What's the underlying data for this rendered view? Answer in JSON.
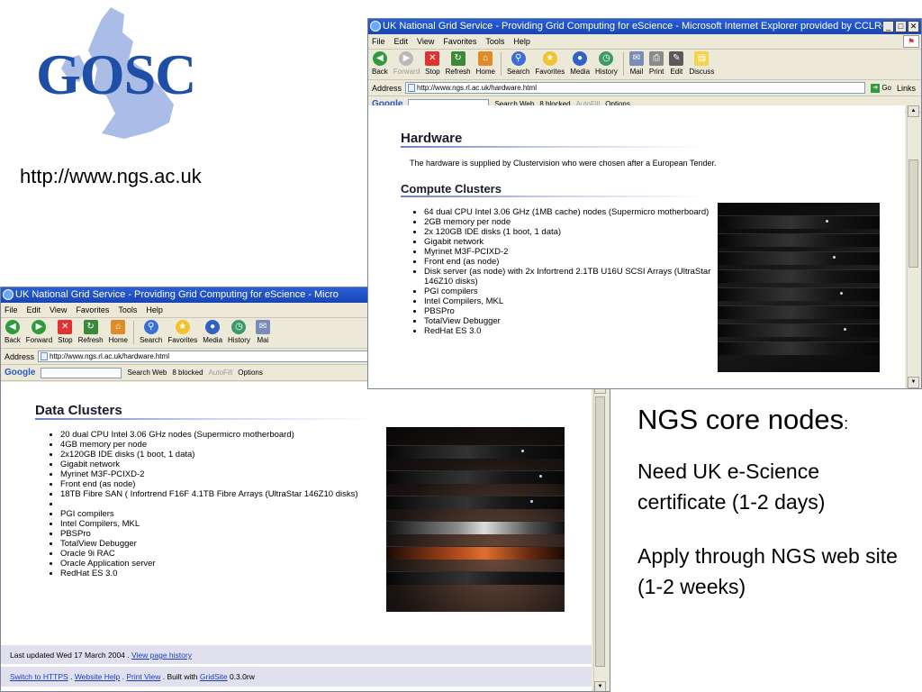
{
  "slide": {
    "logo_text": "GOSC",
    "url": "http://www.ngs.ac.uk",
    "notes_title": "NGS core nodes",
    "notes_title_colon": ":",
    "notes": [
      "Need UK e-Science certificate (1-2 days)",
      "Apply through NGS web site (1-2 weeks)"
    ]
  },
  "back_window": {
    "title": "UK National Grid Service - Providing Grid Computing for eScience - Micro",
    "menu": [
      "File",
      "Edit",
      "View",
      "Favorites",
      "Tools",
      "Help"
    ],
    "toolbar": [
      "Back",
      "Forward",
      "Stop",
      "Refresh",
      "Home",
      "Search",
      "Favorites",
      "Media",
      "History",
      "Mai"
    ],
    "address_label": "Address",
    "address": "http://www.ngs.rl.ac.uk/hardware.html",
    "google": {
      "logo": "Google",
      "search_web": "Search Web",
      "blocked": "8 blocked",
      "autofill": "AutoFill",
      "options": "Options"
    },
    "page": {
      "heading": "Data Clusters",
      "items": [
        "20 dual CPU Intel 3.06 GHz nodes (Supermicro motherboard)",
        "4GB memory per node",
        "2x120GB IDE disks (1 boot, 1 data)",
        "Gigabit network",
        "Myrinet M3F-PCIXD-2",
        "Front end (as node)",
        "18TB Fibre SAN ( Infortrend F16F 4.1TB Fibre Arrays (UltraStar 146Z10 disks)",
        "",
        "PGI compilers",
        "Intel Compilers, MKL",
        "PBSPro",
        "TotalView Debugger",
        "Oracle 9i RAC",
        "Oracle Application server",
        "RedHat ES 3.0"
      ],
      "last_updated": "Last updated Wed 17 March 2004 .",
      "view_history": "View page history",
      "footer_links": {
        "https": "Switch to HTTPS",
        "dot1": " . ",
        "help": "Website Help",
        "dot2": " . ",
        "print": "Print View",
        "built": " . Built with ",
        "gridsite": "GridSite",
        "version": " 0.3.0rw"
      }
    }
  },
  "front_window": {
    "title": "UK National Grid Service - Providing Grid Computing for eScience - Microsoft Internet Explorer provided by CCLRC",
    "menu": [
      "File",
      "Edit",
      "View",
      "Favorites",
      "Tools",
      "Help"
    ],
    "toolbar": [
      "Back",
      "Forward",
      "Stop",
      "Refresh",
      "Home",
      "Search",
      "Favorites",
      "Media",
      "History",
      "Mail",
      "Print",
      "Edit",
      "Discuss"
    ],
    "address_label": "Address",
    "address": "http://www.ngs.rl.ac.uk/hardware.html",
    "go": "Go",
    "links": "Links",
    "google": {
      "logo": "Google",
      "search_web": "Search Web",
      "blocked": "8 blocked",
      "autofill": "AutoFill",
      "options": "Options"
    },
    "page": {
      "heading": "Hardware",
      "intro": "The hardware is supplied by Clustervision who were chosen after a European Tender.",
      "subheading": "Compute Clusters",
      "items": [
        "64 dual CPU Intel 3.06 GHz (1MB cache) nodes (Supermicro motherboard)",
        "2GB memory per node",
        "2x 120GB IDE disks (1 boot, 1 data)",
        "Gigabit network",
        "Myrinet M3F-PCIXD-2",
        "Front end (as node)",
        "Disk server (as node) with 2x Infortrend 2.1TB U16U SCSI Arrays (UltraStar 146Z10 disks)",
        "PGI compilers",
        "Intel Compilers, MKL",
        "PBSPro",
        "TotalView Debugger",
        "RedHat ES 3.0"
      ]
    }
  }
}
